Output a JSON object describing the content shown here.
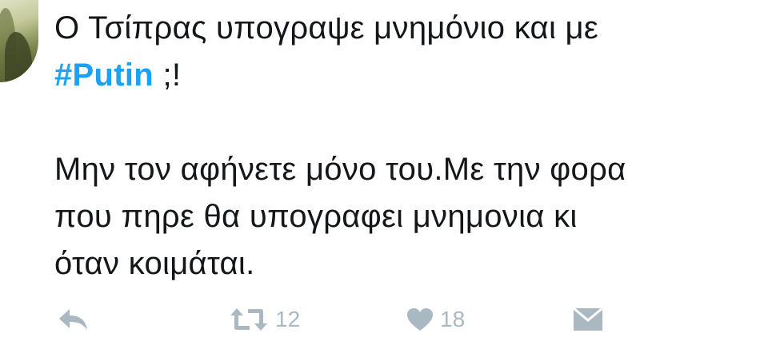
{
  "tweet": {
    "text_before_hashtag": "Ο Τσίπρας υπογραψε μνημόνιο και με",
    "hashtag": "#Putin",
    "text_after_hashtag": " ;!",
    "paragraph2_lines": [
      "Μην τον αφήνετε μόνο του.Με την φορα",
      "που πηρε θα υπογραφει μνημονια κι",
      "όταν κοιμάται."
    ]
  },
  "actions": {
    "reply_icon": "reply-icon",
    "retweet_icon": "retweet-icon",
    "retweet_count": "12",
    "like_icon": "heart-icon",
    "like_count": "18",
    "dm_icon": "envelope-icon"
  },
  "colors": {
    "text": "#14171a",
    "hashtag": "#1da1f2",
    "action_gray": "#aab8c2"
  }
}
